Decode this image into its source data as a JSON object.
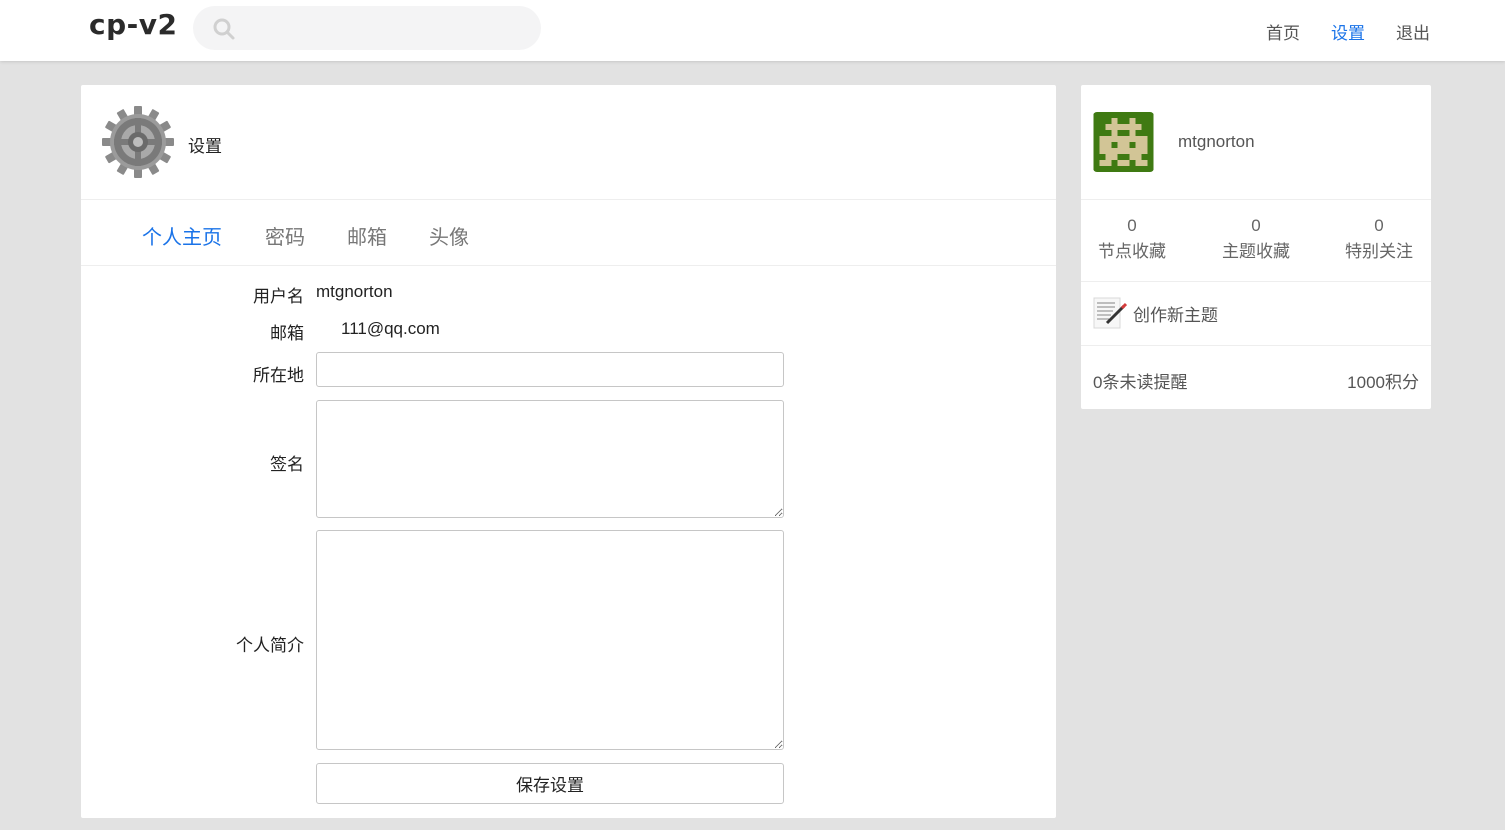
{
  "header": {
    "logo": "cp-v2",
    "search": {
      "placeholder": "",
      "value": ""
    },
    "nav": [
      {
        "label": "首页",
        "active": false
      },
      {
        "label": "设置",
        "active": true
      },
      {
        "label": "退出",
        "active": false
      }
    ]
  },
  "main": {
    "title": "设置",
    "tabs": [
      {
        "label": "个人主页",
        "active": true
      },
      {
        "label": "密码",
        "active": false
      },
      {
        "label": "邮箱",
        "active": false
      },
      {
        "label": "头像",
        "active": false
      }
    ],
    "form": {
      "username_label": "用户名",
      "username_value": "mtgnorton",
      "email_label": "邮箱",
      "email_value": "111@qq.com",
      "location_label": "所在地",
      "location_value": "",
      "signature_label": "签名",
      "signature_value": "",
      "bio_label": "个人简介",
      "bio_value": "",
      "save_label": "保存设置"
    }
  },
  "sidebar": {
    "username": "mtgnorton",
    "stats": [
      {
        "value": "0",
        "label": "节点收藏"
      },
      {
        "value": "0",
        "label": "主题收藏"
      },
      {
        "value": "0",
        "label": "特别关注"
      }
    ],
    "new_topic_label": "创作新主题",
    "unread_label": "0条未读提醒",
    "points_label": "1000积分"
  },
  "colors": {
    "accent": "#1a73e8",
    "background": "#e2e2e2",
    "avatar_bg": "#3f7a12",
    "avatar_fg": "#d2c596"
  }
}
